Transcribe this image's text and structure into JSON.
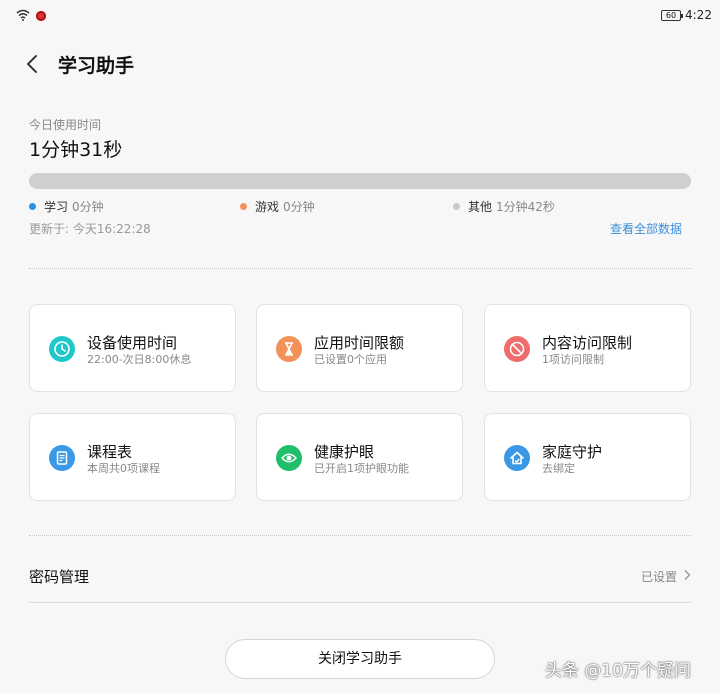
{
  "status_bar": {
    "battery": "60",
    "time": "4:22"
  },
  "header": {
    "title": "学习助手"
  },
  "usage": {
    "label": "今日使用时间",
    "total": "1分钟31秒",
    "legend": [
      {
        "name": "学习",
        "value": "0分钟",
        "color": "#2f8fe0"
      },
      {
        "name": "游戏",
        "value": "0分钟",
        "color": "#f2915a"
      },
      {
        "name": "其他",
        "value": "1分钟42秒",
        "color": "#c9c9c9"
      }
    ],
    "updated": "更新于: 今天16:22:28",
    "view_all": "查看全部数据"
  },
  "cards": [
    {
      "title": "设备使用时间",
      "subtitle": "22:00-次日8:00休息",
      "icon": "clock-icon",
      "color": "#1fc7c9"
    },
    {
      "title": "应用时间限额",
      "subtitle": "已设置0个应用",
      "icon": "hourglass-icon",
      "color": "#f2915a"
    },
    {
      "title": "内容访问限制",
      "subtitle": "1项访问限制",
      "icon": "block-icon",
      "color": "#f06b6b"
    },
    {
      "title": "课程表",
      "subtitle": "本周共0项课程",
      "icon": "schedule-icon",
      "color": "#3a98e6"
    },
    {
      "title": "健康护眼",
      "subtitle": "已开启1项护眼功能",
      "icon": "eye-icon",
      "color": "#1fbf6a"
    },
    {
      "title": "家庭守护",
      "subtitle": "去绑定",
      "icon": "home-shield-icon",
      "color": "#3a98e6"
    }
  ],
  "password": {
    "label": "密码管理",
    "status": "已设置"
  },
  "close_button": {
    "label": "关闭学习助手"
  },
  "watermark": "头条 @10万个疑问"
}
